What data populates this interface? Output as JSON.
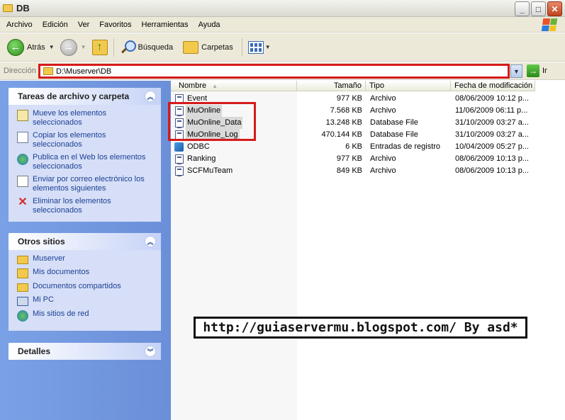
{
  "window": {
    "title": "DB"
  },
  "menu": [
    "Archivo",
    "Edición",
    "Ver",
    "Favoritos",
    "Herramientas",
    "Ayuda"
  ],
  "toolbar": {
    "back_label": "Atrás",
    "search_label": "Búsqueda",
    "folders_label": "Carpetas"
  },
  "address": {
    "label": "Dirección",
    "value": "D:\\Muserver\\DB",
    "go_label": "Ir"
  },
  "tasks_panel": {
    "title": "Tareas de archivo y carpeta",
    "items": [
      {
        "label": "Mueve los elementos seleccionados",
        "icon": "move-icon"
      },
      {
        "label": "Copiar los elementos seleccionados",
        "icon": "copy-icon"
      },
      {
        "label": "Publica en el Web los elementos seleccionados",
        "icon": "web-publish-icon"
      },
      {
        "label": "Enviar por correo electrónico los elementos siguientes",
        "icon": "email-icon"
      },
      {
        "label": "Eliminar los elementos seleccionados",
        "icon": "delete-icon"
      }
    ]
  },
  "places_panel": {
    "title": "Otros sitios",
    "items": [
      {
        "label": "Muserver",
        "icon": "folder-icon"
      },
      {
        "label": "Mis documentos",
        "icon": "documents-icon"
      },
      {
        "label": "Documentos compartidos",
        "icon": "folder-icon"
      },
      {
        "label": "Mi PC",
        "icon": "computer-icon"
      },
      {
        "label": "Mis sitios de red",
        "icon": "network-icon"
      }
    ]
  },
  "details_panel": {
    "title": "Detalles"
  },
  "columns": {
    "name": "Nombre",
    "size": "Tamaño",
    "type": "Tipo",
    "modified": "Fecha de modificación"
  },
  "files": [
    {
      "name": "Event",
      "size": "977 KB",
      "type": "Archivo",
      "modified": "08/06/2009 10:12 p...",
      "selected": false
    },
    {
      "name": "MuOnline",
      "size": "7.568 KB",
      "type": "Archivo",
      "modified": "11/06/2009 06:11 p...",
      "selected": true
    },
    {
      "name": "MuOnline_Data",
      "size": "13.248 KB",
      "type": "Database File",
      "modified": "31/10/2009 03:27 a...",
      "selected": true
    },
    {
      "name": "MuOnline_Log",
      "size": "470.144 KB",
      "type": "Database File",
      "modified": "31/10/2009 03:27 a...",
      "selected": true
    },
    {
      "name": "ODBC",
      "size": "6 KB",
      "type": "Entradas de registro",
      "modified": "10/04/2009 05:27 p...",
      "selected": false
    },
    {
      "name": "Ranking",
      "size": "977 KB",
      "type": "Archivo",
      "modified": "08/06/2009 10:13 p...",
      "selected": false
    },
    {
      "name": "SCFMuTeam",
      "size": "849 KB",
      "type": "Archivo",
      "modified": "08/06/2009 10:13 p...",
      "selected": false
    }
  ],
  "banner": {
    "text": "http://guiaservermu.blogspot.com/ By asd*"
  },
  "colors": {
    "highlight_box": "#d61a1a",
    "task_pane_bg": "#7aa1e6",
    "link_text": "#1c3f94"
  }
}
